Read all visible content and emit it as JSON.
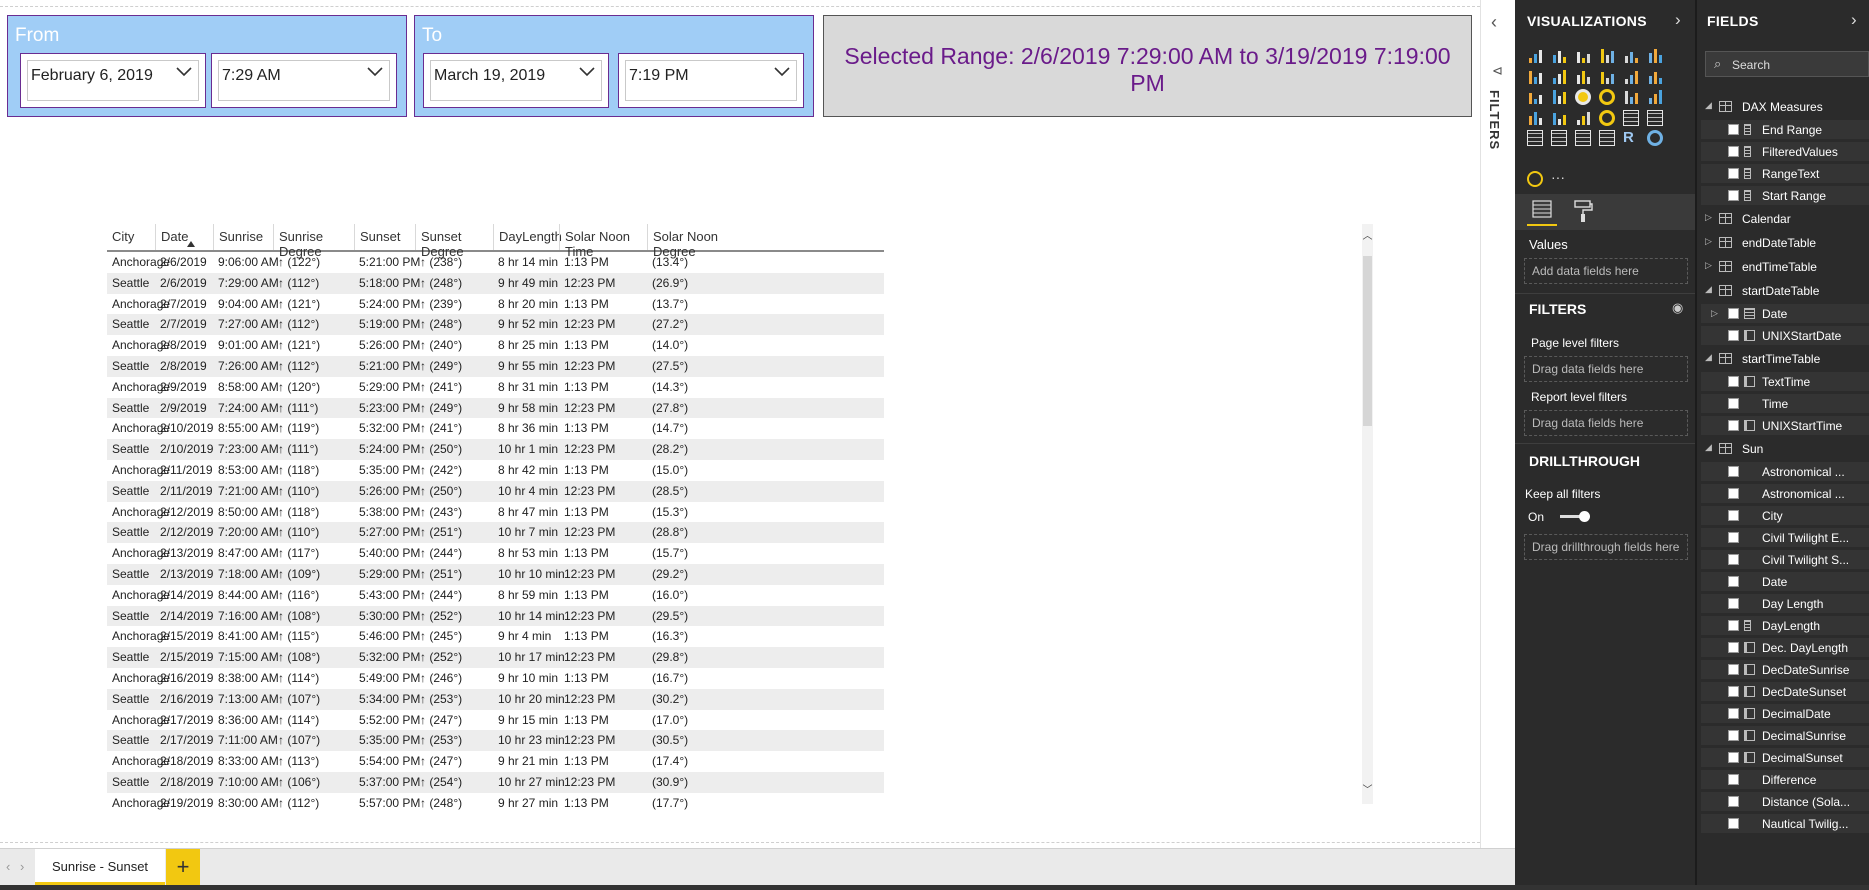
{
  "slicers": {
    "from": {
      "title": "From",
      "date": "February 6, 2019",
      "time": "7:29 AM"
    },
    "to": {
      "title": "To",
      "date": "March 19, 2019",
      "time": "7:19 PM"
    }
  },
  "selected_range": "Selected Range: 2/6/2019 7:29:00 AM to 3/19/2019 7:19:00 PM",
  "table": {
    "columns": [
      "City",
      "Date",
      "Sunrise",
      "Sunrise Degree",
      "Sunset",
      "Sunset Degree",
      "DayLength",
      "Solar Noon Time",
      "Solar Noon Degree"
    ],
    "rows": [
      [
        "Anchorage",
        "2/6/2019",
        "9:06:00 AM",
        "↑ (122°)",
        "5:21:00 PM",
        "↑ (238°)",
        "8 hr 14 min",
        "1:13 PM",
        "(13.4°)"
      ],
      [
        "Seattle",
        "2/6/2019",
        "7:29:00 AM",
        "↑ (112°)",
        "5:18:00 PM",
        "↑ (248°)",
        "9 hr 49 min",
        "12:23 PM",
        "(26.9°)"
      ],
      [
        "Anchorage",
        "2/7/2019",
        "9:04:00 AM",
        "↑ (121°)",
        "5:24:00 PM",
        "↑ (239°)",
        "8 hr 20 min",
        "1:13 PM",
        "(13.7°)"
      ],
      [
        "Seattle",
        "2/7/2019",
        "7:27:00 AM",
        "↑ (112°)",
        "5:19:00 PM",
        "↑ (248°)",
        "9 hr 52 min",
        "12:23 PM",
        "(27.2°)"
      ],
      [
        "Anchorage",
        "2/8/2019",
        "9:01:00 AM",
        "↑ (121°)",
        "5:26:00 PM",
        "↑ (240°)",
        "8 hr 25 min",
        "1:13 PM",
        "(14.0°)"
      ],
      [
        "Seattle",
        "2/8/2019",
        "7:26:00 AM",
        "↑ (112°)",
        "5:21:00 PM",
        "↑ (249°)",
        "9 hr 55 min",
        "12:23 PM",
        "(27.5°)"
      ],
      [
        "Anchorage",
        "2/9/2019",
        "8:58:00 AM",
        "↑ (120°)",
        "5:29:00 PM",
        "↑ (241°)",
        "8 hr 31 min",
        "1:13 PM",
        "(14.3°)"
      ],
      [
        "Seattle",
        "2/9/2019",
        "7:24:00 AM",
        "↑ (111°)",
        "5:23:00 PM",
        "↑ (249°)",
        "9 hr 58 min",
        "12:23 PM",
        "(27.8°)"
      ],
      [
        "Anchorage",
        "2/10/2019",
        "8:55:00 AM",
        "↑ (119°)",
        "5:32:00 PM",
        "↑ (241°)",
        "8 hr 36 min",
        "1:13 PM",
        "(14.7°)"
      ],
      [
        "Seattle",
        "2/10/2019",
        "7:23:00 AM",
        "↑ (111°)",
        "5:24:00 PM",
        "↑ (250°)",
        "10 hr 1 min",
        "12:23 PM",
        "(28.2°)"
      ],
      [
        "Anchorage",
        "2/11/2019",
        "8:53:00 AM",
        "↑ (118°)",
        "5:35:00 PM",
        "↑ (242°)",
        "8 hr 42 min",
        "1:13 PM",
        "(15.0°)"
      ],
      [
        "Seattle",
        "2/11/2019",
        "7:21:00 AM",
        "↑ (110°)",
        "5:26:00 PM",
        "↑ (250°)",
        "10 hr 4 min",
        "12:23 PM",
        "(28.5°)"
      ],
      [
        "Anchorage",
        "2/12/2019",
        "8:50:00 AM",
        "↑ (118°)",
        "5:38:00 PM",
        "↑ (243°)",
        "8 hr 47 min",
        "1:13 PM",
        "(15.3°)"
      ],
      [
        "Seattle",
        "2/12/2019",
        "7:20:00 AM",
        "↑ (110°)",
        "5:27:00 PM",
        "↑ (251°)",
        "10 hr 7 min",
        "12:23 PM",
        "(28.8°)"
      ],
      [
        "Anchorage",
        "2/13/2019",
        "8:47:00 AM",
        "↑ (117°)",
        "5:40:00 PM",
        "↑ (244°)",
        "8 hr 53 min",
        "1:13 PM",
        "(15.7°)"
      ],
      [
        "Seattle",
        "2/13/2019",
        "7:18:00 AM",
        "↑ (109°)",
        "5:29:00 PM",
        "↑ (251°)",
        "10 hr 10 min",
        "12:23 PM",
        "(29.2°)"
      ],
      [
        "Anchorage",
        "2/14/2019",
        "8:44:00 AM",
        "↑ (116°)",
        "5:43:00 PM",
        "↑ (244°)",
        "8 hr 59 min",
        "1:13 PM",
        "(16.0°)"
      ],
      [
        "Seattle",
        "2/14/2019",
        "7:16:00 AM",
        "↑ (108°)",
        "5:30:00 PM",
        "↑ (252°)",
        "10 hr 14 min",
        "12:23 PM",
        "(29.5°)"
      ],
      [
        "Anchorage",
        "2/15/2019",
        "8:41:00 AM",
        "↑ (115°)",
        "5:46:00 PM",
        "↑ (245°)",
        "9 hr 4 min",
        "1:13 PM",
        "(16.3°)"
      ],
      [
        "Seattle",
        "2/15/2019",
        "7:15:00 AM",
        "↑ (108°)",
        "5:32:00 PM",
        "↑ (252°)",
        "10 hr 17 min",
        "12:23 PM",
        "(29.8°)"
      ],
      [
        "Anchorage",
        "2/16/2019",
        "8:38:00 AM",
        "↑ (114°)",
        "5:49:00 PM",
        "↑ (246°)",
        "9 hr 10 min",
        "1:13 PM",
        "(16.7°)"
      ],
      [
        "Seattle",
        "2/16/2019",
        "7:13:00 AM",
        "↑ (107°)",
        "5:34:00 PM",
        "↑ (253°)",
        "10 hr 20 min",
        "12:23 PM",
        "(30.2°)"
      ],
      [
        "Anchorage",
        "2/17/2019",
        "8:36:00 AM",
        "↑ (114°)",
        "5:52:00 PM",
        "↑ (247°)",
        "9 hr 15 min",
        "1:13 PM",
        "(17.0°)"
      ],
      [
        "Seattle",
        "2/17/2019",
        "7:11:00 AM",
        "↑ (107°)",
        "5:35:00 PM",
        "↑ (253°)",
        "10 hr 23 min",
        "12:23 PM",
        "(30.5°)"
      ],
      [
        "Anchorage",
        "2/18/2019",
        "8:33:00 AM",
        "↑ (113°)",
        "5:54:00 PM",
        "↑ (247°)",
        "9 hr 21 min",
        "1:13 PM",
        "(17.4°)"
      ],
      [
        "Seattle",
        "2/18/2019",
        "7:10:00 AM",
        "↑ (106°)",
        "5:37:00 PM",
        "↑ (254°)",
        "10 hr 27 min",
        "12:23 PM",
        "(30.9°)"
      ],
      [
        "Anchorage",
        "2/19/2019",
        "8:30:00 AM",
        "↑ (112°)",
        "5:57:00 PM",
        "↑ (248°)",
        "9 hr 27 min",
        "1:13 PM",
        "(17.7°)"
      ]
    ]
  },
  "filters_strip": {
    "label": "FILTERS",
    "collapse_icon": "chevron-left-icon"
  },
  "page_tabs": {
    "active": "Sunrise - Sunset",
    "add_label": "+"
  },
  "visualizations": {
    "title": "VISUALIZATIONS",
    "values_label": "Values",
    "values_well": "Add data fields here",
    "filters_title": "FILTERS",
    "page_filters": "Page level filters",
    "page_filters_well": "Drag data fields here",
    "report_filters": "Report level filters",
    "report_filters_well": "Drag data fields here",
    "drillthrough_title": "DRILLTHROUGH",
    "keep_all_filters": "Keep all filters",
    "toggle_state": "On",
    "drillthrough_well": "Drag drillthrough fields here",
    "more_label": "···",
    "r_label": "R"
  },
  "fields": {
    "title": "FIELDS",
    "search_placeholder": "Search",
    "items": [
      {
        "kind": "table",
        "name": "DAX Measures",
        "icon": "calculator-icon"
      },
      {
        "kind": "field",
        "name": "End Range",
        "icon": "measure-icon"
      },
      {
        "kind": "field",
        "name": "FilteredValues",
        "icon": "measure-icon"
      },
      {
        "kind": "field",
        "name": "RangeText",
        "icon": "measure-icon"
      },
      {
        "kind": "field",
        "name": "Start Range",
        "icon": "measure-icon"
      },
      {
        "kind": "table",
        "name": "Calendar",
        "icon": "table-icon"
      },
      {
        "kind": "table",
        "name": "endDateTable",
        "icon": "table-icon"
      },
      {
        "kind": "table",
        "name": "endTimeTable",
        "icon": "table-icon"
      },
      {
        "kind": "table",
        "name": "startDateTable",
        "icon": "table-icon"
      },
      {
        "kind": "field",
        "name": "Date",
        "icon": "hierarchy-icon"
      },
      {
        "kind": "field",
        "name": "UNIXStartDate",
        "icon": "calc-column-icon"
      },
      {
        "kind": "table",
        "name": "startTimeTable",
        "icon": "table-icon"
      },
      {
        "kind": "field",
        "name": "TextTime",
        "icon": "calc-column-icon"
      },
      {
        "kind": "field",
        "name": "Time",
        "icon": "none"
      },
      {
        "kind": "field",
        "name": "UNIXStartTime",
        "icon": "calc-column-icon"
      },
      {
        "kind": "table",
        "name": "Sun",
        "icon": "table-icon"
      },
      {
        "kind": "field",
        "name": "Astronomical ...",
        "icon": "none"
      },
      {
        "kind": "field",
        "name": "Astronomical ...",
        "icon": "none"
      },
      {
        "kind": "field",
        "name": "City",
        "icon": "none"
      },
      {
        "kind": "field",
        "name": "Civil Twilight E...",
        "icon": "none"
      },
      {
        "kind": "field",
        "name": "Civil Twilight S...",
        "icon": "none"
      },
      {
        "kind": "field",
        "name": "Date",
        "icon": "none"
      },
      {
        "kind": "field",
        "name": "Day Length",
        "icon": "none"
      },
      {
        "kind": "field",
        "name": "DayLength",
        "icon": "measure-icon"
      },
      {
        "kind": "field",
        "name": "Dec. DayLength",
        "icon": "calc-column-icon"
      },
      {
        "kind": "field",
        "name": "DecDateSunrise",
        "icon": "calc-column-icon"
      },
      {
        "kind": "field",
        "name": "DecDateSunset",
        "icon": "calc-column-icon"
      },
      {
        "kind": "field",
        "name": "DecimalDate",
        "icon": "calc-column-icon"
      },
      {
        "kind": "field",
        "name": "DecimalSunrise",
        "icon": "calc-column-icon"
      },
      {
        "kind": "field",
        "name": "DecimalSunset",
        "icon": "calc-column-icon"
      },
      {
        "kind": "field",
        "name": "Difference",
        "icon": "none"
      },
      {
        "kind": "field",
        "name": "Distance (Sola...",
        "icon": "none"
      },
      {
        "kind": "field",
        "name": "Nautical Twilig...",
        "icon": "none"
      }
    ]
  },
  "colors": {
    "slicer_bg": "#a0cdf6",
    "slicer_border": "#6a2c91",
    "range_text": "#6a1b8a",
    "accent": "#f2c811",
    "pane_bg": "#2b2b2b"
  }
}
